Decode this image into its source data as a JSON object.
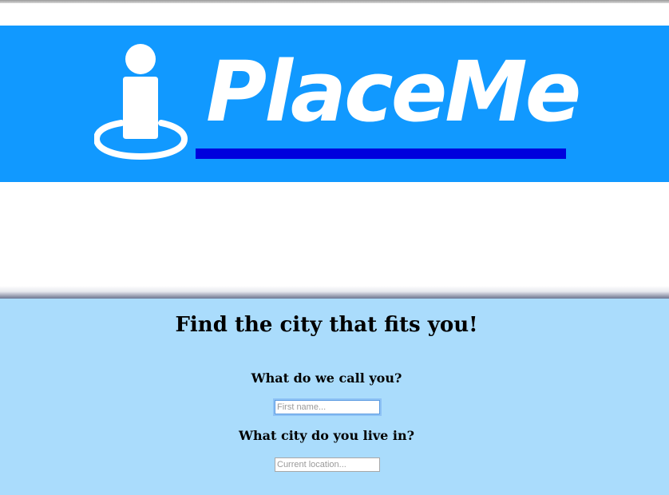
{
  "header": {
    "logo_text": "PlaceMe",
    "logo_alt": "PlaceMe logo",
    "colors": {
      "banner_bg": "#1199ff",
      "link_underline": "#0000dd",
      "logo_fg": "#ffffff"
    }
  },
  "form": {
    "title": "Find the city that fits you!",
    "name_question": "What do we call you?",
    "name_placeholder": "First name...",
    "name_value": "",
    "city_question": "What city do you live in?",
    "city_placeholder": "Current location...",
    "city_value": "",
    "colors": {
      "section_bg": "#aadcfc"
    }
  }
}
